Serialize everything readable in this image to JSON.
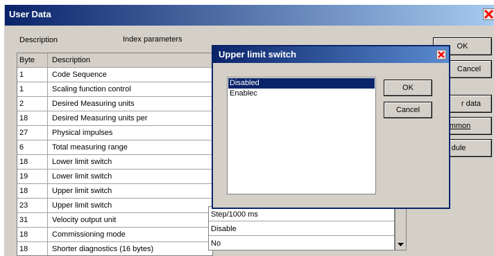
{
  "window": {
    "title": "User Data",
    "colors": {
      "title_from": "#0a246a",
      "title_to": "#a6caf0",
      "close": "#ff0000"
    }
  },
  "header": {
    "description_label": "Description",
    "index_params_label": "Index parameters"
  },
  "table": {
    "columns": [
      "Byte",
      "Description"
    ],
    "rows": [
      {
        "byte": "1",
        "desc": "Code Sequence"
      },
      {
        "byte": "1",
        "desc": "Scaling function control"
      },
      {
        "byte": "2",
        "desc": "Desired Measuring units"
      },
      {
        "byte": "18",
        "desc": "Desired Measuring units per"
      },
      {
        "byte": "27",
        "desc": "Physical impulses"
      },
      {
        "byte": "6",
        "desc": "Total measuring range"
      },
      {
        "byte": "18",
        "desc": "Lower limit switch"
      },
      {
        "byte": "19",
        "desc": "Lower limit switch"
      },
      {
        "byte": "18",
        "desc": "Upper limit switch"
      },
      {
        "byte": "23",
        "desc": "Upper limit switch"
      },
      {
        "byte": "31",
        "desc": "Velocity output unit"
      },
      {
        "byte": "18",
        "desc": "Commissioning mode"
      },
      {
        "byte": "18",
        "desc": "Shorter diagnostics (16 bytes)"
      }
    ]
  },
  "values": {
    "velocity_output_unit": "Step/1000 ms",
    "commissioning_mode": "Disable",
    "shorter_diagnostics": "No"
  },
  "side_buttons": {
    "ok": "OK",
    "cancel": "Cancel",
    "data_partial": "r data",
    "common_partial": "mmon",
    "module_partial": "dule"
  },
  "dialog": {
    "title": "Upper limit switch",
    "options": [
      "Disabled",
      "Enablec"
    ],
    "selected": "Disabled",
    "ok": "OK",
    "cancel": "Cancel",
    "colors": {
      "selection": "#0a246a"
    }
  }
}
